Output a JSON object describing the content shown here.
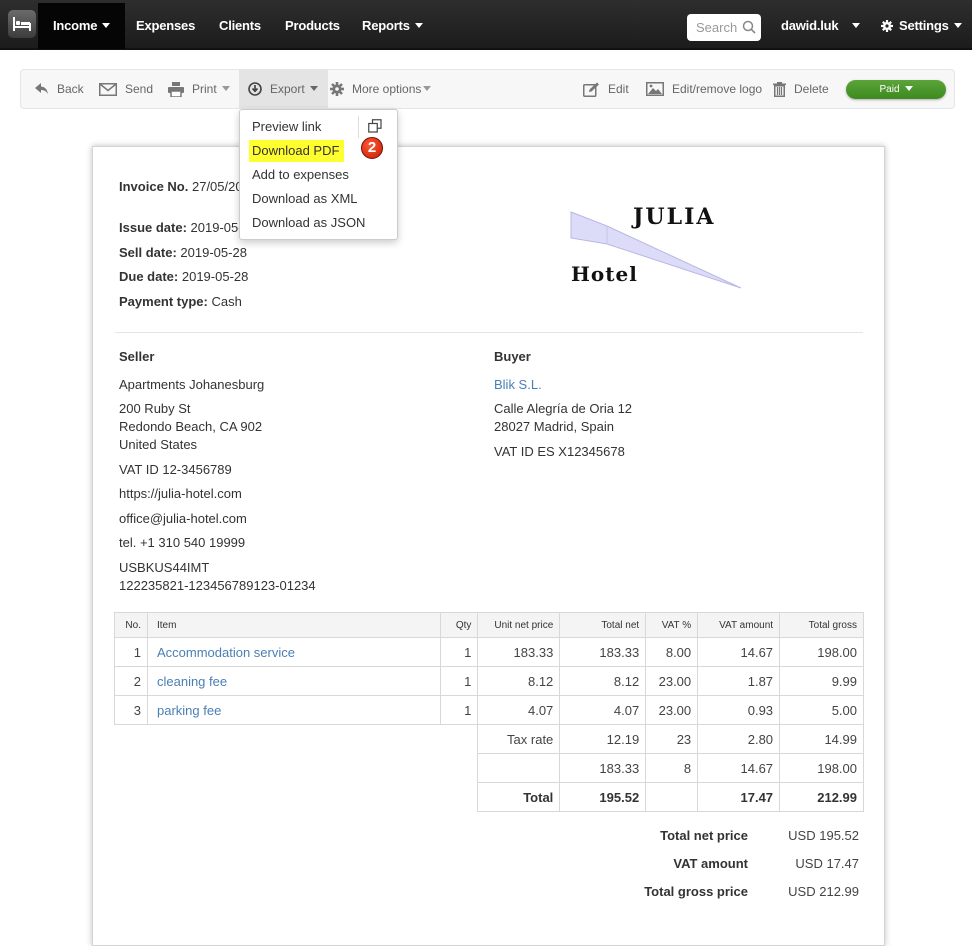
{
  "topnav": {
    "logo_icon": "bed-icon",
    "items": [
      {
        "label": "Income",
        "has_caret": true,
        "active": true
      },
      {
        "label": "Expenses",
        "has_caret": false
      },
      {
        "label": "Clients",
        "has_caret": false
      },
      {
        "label": "Products",
        "has_caret": false
      },
      {
        "label": "Reports",
        "has_caret": true
      }
    ],
    "search_placeholder": "Search",
    "user": "dawid.luk",
    "settings_label": "Settings"
  },
  "toolbar": {
    "back": "Back",
    "send": "Send",
    "print": "Print",
    "export": "Export",
    "more_options": "More options",
    "edit": "Edit",
    "edit_logo": "Edit/remove logo",
    "delete": "Delete",
    "status": "Paid",
    "status_color": "#4a9a2b"
  },
  "export_menu": {
    "items": [
      "Preview link",
      "Download PDF",
      "Add to expenses",
      "Download as XML",
      "Download as JSON"
    ],
    "highlighted": "Download PDF",
    "step_badge": "2",
    "highlight_color": "#ffff30"
  },
  "invoice": {
    "number_label": "Invoice No.",
    "number_value": "27/05/20",
    "issue_label": "Issue date:",
    "issue_value": "2019-05-",
    "sell_label": "Sell date:",
    "sell_value": "2019-05-28",
    "due_label": "Due date:",
    "due_value": "2019-05-28",
    "payment_label": "Payment type:",
    "payment_value": "Cash",
    "logo": {
      "line1": "JULIA",
      "line2": "Hotel"
    }
  },
  "seller": {
    "title": "Seller",
    "name": "Apartments Johanesburg",
    "address1": "200 Ruby St",
    "address2": "Redondo Beach, CA 902",
    "country": "United States",
    "vat": "VAT ID 12-3456789",
    "website": "https://julia-hotel.com",
    "email": "office@julia-hotel.com",
    "phone": "tel. +1 310 540 19999",
    "swift": "USBKUS44IMT",
    "account": "122235821-123456789123-01234"
  },
  "buyer": {
    "title": "Buyer",
    "name": "Blik S.L.",
    "address1": "Calle Alegría de Oria 12",
    "address2": "28027 Madrid, Spain",
    "vat": "VAT ID ES X12345678"
  },
  "table": {
    "headers": [
      "No.",
      "Item",
      "Qty",
      "Unit net price",
      "Total net",
      "VAT %",
      "VAT amount",
      "Total gross"
    ],
    "rows": [
      {
        "no": "1",
        "item": "Accommodation service",
        "qty": "1",
        "unit": "183.33",
        "net": "183.33",
        "vat_pct": "8.00",
        "vat_amt": "14.67",
        "gross": "198.00"
      },
      {
        "no": "2",
        "item": "cleaning fee",
        "qty": "1",
        "unit": "8.12",
        "net": "8.12",
        "vat_pct": "23.00",
        "vat_amt": "1.87",
        "gross": "9.99"
      },
      {
        "no": "3",
        "item": "parking fee",
        "qty": "1",
        "unit": "4.07",
        "net": "4.07",
        "vat_pct": "23.00",
        "vat_amt": "0.93",
        "gross": "5.00"
      }
    ],
    "tax_rate_label": "Tax rate",
    "tax_rows": [
      {
        "net": "12.19",
        "rate": "23",
        "vat": "2.80",
        "gross": "14.99"
      },
      {
        "net": "183.33",
        "rate": "8",
        "vat": "14.67",
        "gross": "198.00"
      }
    ],
    "total_label": "Total",
    "total": {
      "net": "195.52",
      "vat": "17.47",
      "gross": "212.99"
    }
  },
  "summary": {
    "net_label": "Total net price",
    "net_value": "USD 195.52",
    "vat_label": "VAT amount",
    "vat_value": "USD 17.47",
    "gross_label": "Total gross price",
    "gross_value": "USD 212.99"
  }
}
